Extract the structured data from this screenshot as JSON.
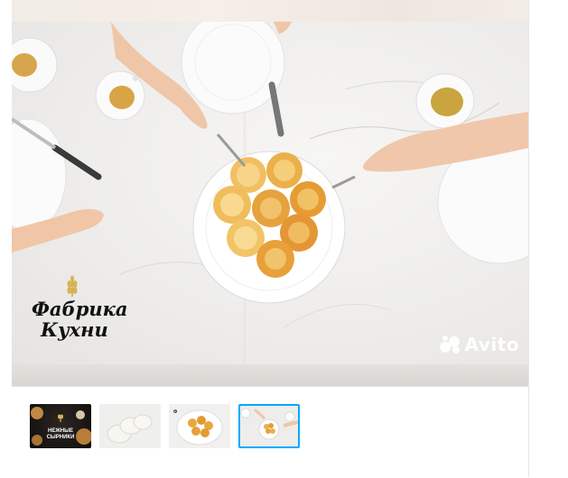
{
  "gallery": {
    "main_image": {
      "subject": "syrniki-on-plate-table-scene",
      "brand_logo": {
        "line1": "Фабрика",
        "line2": "Кухни"
      },
      "watermark": "Avito"
    },
    "thumbnails": [
      {
        "caption_line1": "НЕЖНЫЕ",
        "caption_line2": "СЫРНИКИ",
        "active": false
      },
      {
        "caption_line1": "",
        "caption_line2": "",
        "active": false
      },
      {
        "caption_line1": "",
        "caption_line2": "",
        "active": false
      },
      {
        "caption_line1": "",
        "caption_line2": "",
        "active": true
      }
    ]
  },
  "colors": {
    "active_border": "#00aaff",
    "syrniki": "#e8a53a",
    "table": "#eeedeb"
  },
  "icons": [
    "wheat-icon",
    "avito-logo-icon"
  ]
}
